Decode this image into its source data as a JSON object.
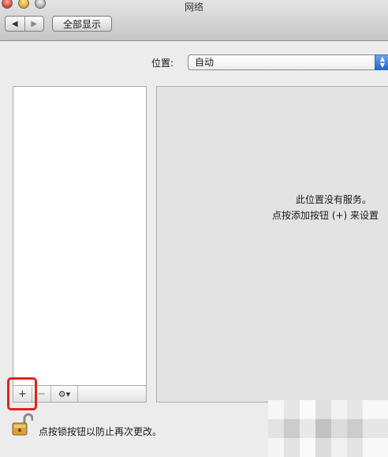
{
  "window": {
    "title": "网络"
  },
  "toolbar": {
    "back_label": "◀",
    "forward_label": "▶",
    "show_all_label": "全部显示"
  },
  "location": {
    "label": "位置:",
    "selected": "自动"
  },
  "service_list": {
    "items": [],
    "add_label": "+",
    "remove_label": "−",
    "gear_label": "⚙▾"
  },
  "detail": {
    "empty_line1": "此位置没有服务。",
    "empty_line2": "点按添加按钮 (+) 来设置"
  },
  "lock": {
    "text": "点按锁按钮以防止再次更改。"
  },
  "colors": {
    "highlight": "#e2231a",
    "select_arrow": "#2a6ccc"
  }
}
